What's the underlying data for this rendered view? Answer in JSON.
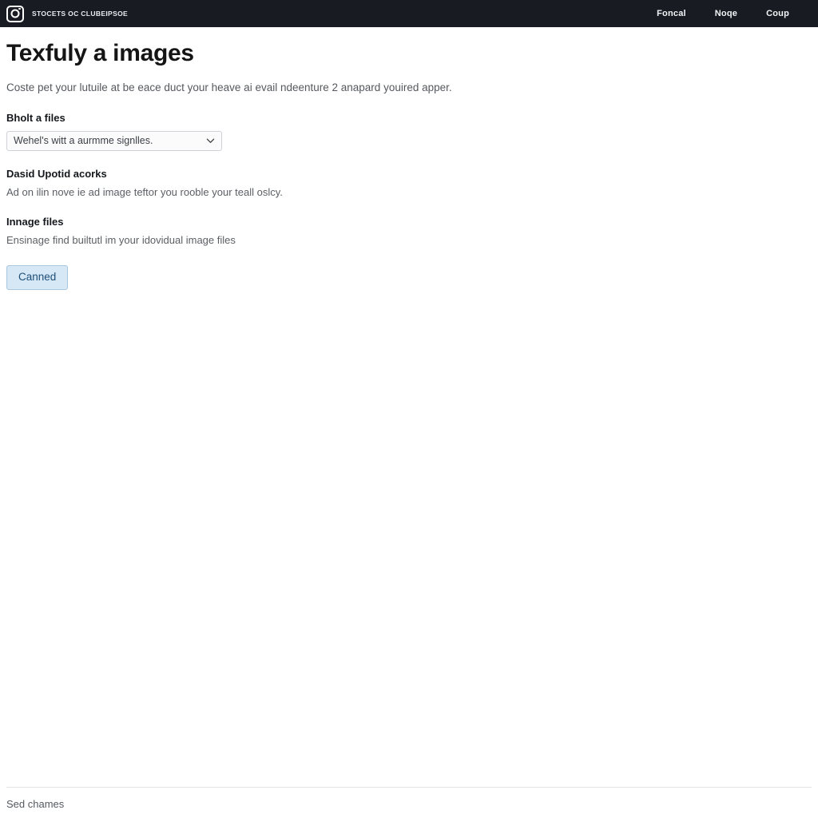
{
  "topbar": {
    "logo_icon": "camera-logo-icon",
    "brand_text": "STOCETS OC CLUBEIPSOE",
    "nav": [
      {
        "label": "Foncal"
      },
      {
        "label": "Noqe"
      },
      {
        "label": "Coup"
      }
    ]
  },
  "main": {
    "title": "Texfuly a images",
    "subtitle": "Coste pet your lutuile at be eace duct your heave ai evail ndeenture 2 anapard youired apper.",
    "select_section": {
      "label": "Bholt a files",
      "value": "Wehel's witt a aurmme signlles.",
      "caret_icon": "chevron-down-icon"
    },
    "upload_section": {
      "label": "Dasid Upotid acorks",
      "description": "Ad on ilin nove ie ad image teftor you rooble your teall oslcy."
    },
    "image_section": {
      "label": "Innage files",
      "description": "Ensinage find builtutl im your idovidual image files"
    },
    "submit_button": "Canned"
  },
  "footer": {
    "text": "Sed chames"
  },
  "colors": {
    "topbar_bg": "#181c22",
    "button_bg": "#d6e7f5",
    "button_border": "#a9c8df",
    "button_text": "#1d4f78",
    "page_bg": "#ffffff"
  }
}
